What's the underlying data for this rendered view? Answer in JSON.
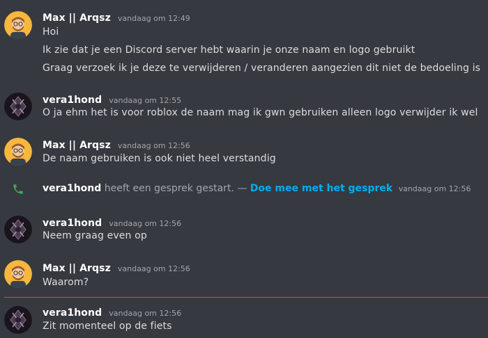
{
  "colors": {
    "background": "#36393f",
    "username": "#ffffff",
    "text": "#dcddde",
    "timestamp": "#a3a6aa",
    "link": "#00aff4",
    "call_icon": "#3ba55d",
    "new_divider": "#ed4245"
  },
  "messages": [
    {
      "author": "Max || Arqsz",
      "avatar_icon": "cartoon-man-avatar-icon",
      "timestamp": "vandaag om 12:49",
      "lines": [
        "Hoi",
        "Ik zie dat je een Discord server hebt waarin je onze naam en logo gebruikt",
        "Graag verzoek ik je deze te verwijderen / veranderen aangezien dit niet de bedoeling is"
      ]
    },
    {
      "author": "vera1hond",
      "avatar_icon": "dark-emblem-avatar-icon",
      "timestamp": "vandaag om 12:55",
      "lines": [
        "O ja ehm het is voor roblox de naam mag ik gwn gebruiken alleen logo verwijder ik wel"
      ]
    },
    {
      "author": "Max || Arqsz",
      "avatar_icon": "cartoon-man-avatar-icon",
      "timestamp": "vandaag om 12:56",
      "lines": [
        "De naam gebruiken is ook niet heel verstandig"
      ]
    },
    {
      "author": "vera1hond",
      "avatar_icon": "dark-emblem-avatar-icon",
      "timestamp": "vandaag om 12:56",
      "lines": [
        "Neem graag even op"
      ]
    },
    {
      "author": "Max || Arqsz",
      "avatar_icon": "cartoon-man-avatar-icon",
      "timestamp": "vandaag om 12:56",
      "lines": [
        "Waarom?"
      ]
    },
    {
      "author": "vera1hond",
      "avatar_icon": "dark-emblem-avatar-icon",
      "timestamp": "vandaag om 12:56",
      "lines": [
        "Zit momenteel op de fiets"
      ]
    }
  ],
  "call_event": {
    "icon": "phone-icon",
    "user": "vera1hond",
    "text": "heeft een gesprek gestart. —",
    "join_link": "Doe mee met het gesprek",
    "timestamp": "vandaag om 12:56"
  }
}
